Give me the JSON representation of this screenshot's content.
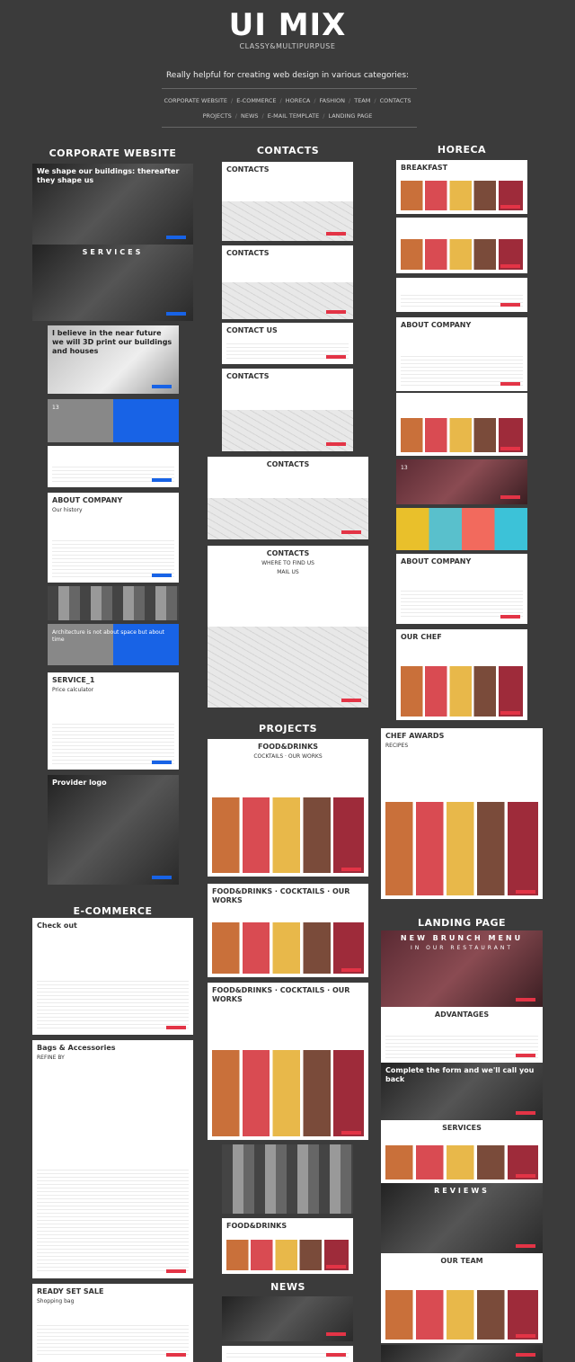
{
  "header": {
    "title": "UI MIX",
    "subtitle": "CLASSY&MULTIPURPUSE",
    "tagline": "Really helpful for creating web design in various categories:",
    "categories_row1": [
      "CORPORATE WEBSITE",
      "E-COMMERCE",
      "HORECA",
      "FASHION",
      "TEAM",
      "CONTACTS"
    ],
    "categories_row2": [
      "PROJECTS",
      "NEWS",
      "E-MAIL TEMPLATE",
      "LANDING PAGE"
    ]
  },
  "sections": {
    "corporate": "CORPORATE WEBSITE",
    "ecommerce": "E-COMMERCE",
    "contacts": "CONTACTS",
    "projects": "PROJECTS",
    "news": "NEWS",
    "horeca": "HORECA",
    "landing": "LANDING PAGE"
  },
  "colors": {
    "background": "#3b3b3b",
    "accent_blue": "#1863e6",
    "accent_red": "#e33446",
    "accent_teal": "#3cc2d8"
  },
  "thumbs": {
    "c1": [
      "We shape our buildings: thereafter they shape us"
    ],
    "c2": [
      "SERVICES"
    ],
    "c3": [
      "I believe in the near future we will 3D print our buildings and houses"
    ],
    "c4": [
      "",
      "13"
    ],
    "c5": [
      ""
    ],
    "c6": [
      "ABOUT COMPANY",
      "Our history"
    ],
    "c7": [
      ""
    ],
    "c8": [
      "",
      "Architecture is not about space but about time"
    ],
    "c9": [
      "SERVICE_1",
      "Price calculator"
    ],
    "c10": [
      "Provider logo"
    ],
    "e1": [
      "Check out"
    ],
    "e2": [
      "Bags & Accessories",
      "REFINE BY"
    ],
    "e3": [
      "READY SET SALE",
      "Shopping bag"
    ],
    "m1": [
      "CONTACTS"
    ],
    "m2": [
      "CONTACTS"
    ],
    "m3": [
      "CONTACT US"
    ],
    "m4": [
      "CONTACTS"
    ],
    "m5": [
      "CONTACTS"
    ],
    "m6": [
      "CONTACTS",
      "WHERE TO FIND US",
      "MAIL US"
    ],
    "p1": [
      "FOOD&DRINKS",
      "COCKTAILS · OUR WORKS"
    ],
    "p2": [
      "FOOD&DRINKS · COCKTAILS · OUR WORKS"
    ],
    "p3": [
      "FOOD&DRINKS · COCKTAILS · OUR WORKS"
    ],
    "p4": [
      ""
    ],
    "p5": [
      "FOOD&DRINKS"
    ],
    "n1": [
      ""
    ],
    "n2": [
      ""
    ],
    "h1": [
      "BREAKFAST"
    ],
    "h2": [
      ""
    ],
    "h3": [
      ""
    ],
    "h4": [
      "ABOUT COMPANY"
    ],
    "h5": [
      ""
    ],
    "h6": [
      "",
      "13"
    ],
    "h7": [
      ""
    ],
    "h8": [
      "ABOUT COMPANY"
    ],
    "h9": [
      "OUR CHEF"
    ],
    "h10": [
      "CHEF AWARDS",
      "RECIPES"
    ],
    "l1": [
      "NEW BRUNCH MENU",
      "IN OUR RESTAURANT"
    ],
    "l2": [
      "ADVANTAGES"
    ],
    "l3": [
      "Complete the form and we'll call you back"
    ],
    "l4": [
      "SERVICES"
    ],
    "l5": [
      "REVIEWS"
    ],
    "l6": [
      "OUR TEAM"
    ],
    "l7": [
      ""
    ]
  }
}
